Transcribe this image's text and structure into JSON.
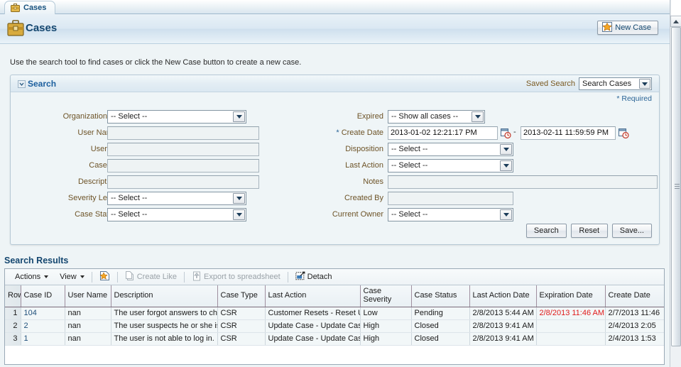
{
  "tab": {
    "label": "Cases",
    "icon": "briefcase-icon"
  },
  "header": {
    "title": "Cases",
    "icon": "briefcase-icon",
    "new_case_label": "New Case",
    "new_case_icon": "new-case-icon"
  },
  "instruction": "Use the search tool to find cases or click the New Case button to create a new case.",
  "search": {
    "legend": "Search",
    "disclosure_icon": "chevron-down-icon",
    "saved_search_label": "Saved Search",
    "saved_search_value": "Search Cases",
    "required_note": "* Required",
    "left_fields": [
      {
        "label": "Organization ID",
        "type": "select",
        "value": "-- Select --"
      },
      {
        "label": "User Name",
        "type": "text",
        "value": ""
      },
      {
        "label": "User ID",
        "type": "text",
        "value": ""
      },
      {
        "label": "Case ID",
        "type": "text",
        "value": ""
      },
      {
        "label": "Description",
        "type": "text",
        "value": ""
      },
      {
        "label": "Severity Level",
        "type": "select",
        "value": "-- Select --"
      },
      {
        "label": "Case Status",
        "type": "select",
        "value": "-- Select --"
      }
    ],
    "right_fields": [
      {
        "label": "Expired",
        "type": "select",
        "value": "-- Show all cases --"
      },
      {
        "label": "Create Date",
        "type": "daterange",
        "required": true,
        "value_from": "2013-01-02 12:21:17 PM",
        "value_to": "2013-02-11 11:59:59 PM",
        "separator": "-",
        "icon": "calendar-icon"
      },
      {
        "label": "Disposition",
        "type": "select",
        "value": "-- Select --"
      },
      {
        "label": "Last Action",
        "type": "select",
        "value": "-- Select --"
      },
      {
        "label": "Notes",
        "type": "text",
        "value": ""
      },
      {
        "label": "Created By",
        "type": "text",
        "value": ""
      },
      {
        "label": "Current Owner",
        "type": "select",
        "value": "-- Select --"
      }
    ],
    "buttons": [
      {
        "label": "Search"
      },
      {
        "label": "Reset"
      },
      {
        "label": "Save..."
      }
    ]
  },
  "results": {
    "title": "Search Results",
    "toolbar": {
      "actions_label": "Actions",
      "view_label": "View",
      "create_icon": "create-new-icon",
      "create_like_label": "Create Like",
      "create_like_icon": "create-like-icon",
      "export_label": "Export to spreadsheet",
      "export_icon": "export-spreadsheet-icon",
      "detach_label": "Detach",
      "detach_icon": "detach-icon"
    },
    "columns": [
      "Row",
      "Case ID",
      "User Name",
      "Description",
      "Case Type",
      "Last Action",
      "Case Severity",
      "Case Status",
      "Last Action Date",
      "Expiration Date",
      "Create Date"
    ],
    "rows": [
      {
        "row": "1",
        "case_id": "104",
        "user_name": "nan",
        "description": "The user forgot answers to ch",
        "case_type": "CSR",
        "last_action": "Customer Resets - Reset U",
        "case_severity": "Low",
        "case_status": "Pending",
        "last_action_date": "2/8/2013 5:44 AM",
        "expiration_date": "2/8/2013 11:46 AM",
        "create_date": "2/7/2013 11:46"
      },
      {
        "row": "2",
        "case_id": "2",
        "user_name": "nan",
        "description": "The user suspects he or she is",
        "case_type": "CSR",
        "last_action": "Update Case - Update Case",
        "case_severity": "High",
        "case_status": "Closed",
        "last_action_date": "2/8/2013 9:41 AM",
        "expiration_date": "",
        "create_date": "2/4/2013 2:05"
      },
      {
        "row": "3",
        "case_id": "1",
        "user_name": "nan",
        "description": "The user is not able to log in.",
        "case_type": "CSR",
        "last_action": "Update Case - Update Case",
        "case_severity": "High",
        "case_status": "Closed",
        "last_action_date": "2/8/2013 9:41 AM",
        "expiration_date": "",
        "create_date": "2/4/2013 1:53"
      }
    ]
  },
  "colors": {
    "title_blue": "#13466f",
    "label_brown": "#6d5327",
    "expired_red": "#e01b1b",
    "link_blue": "#1f4f7a"
  }
}
